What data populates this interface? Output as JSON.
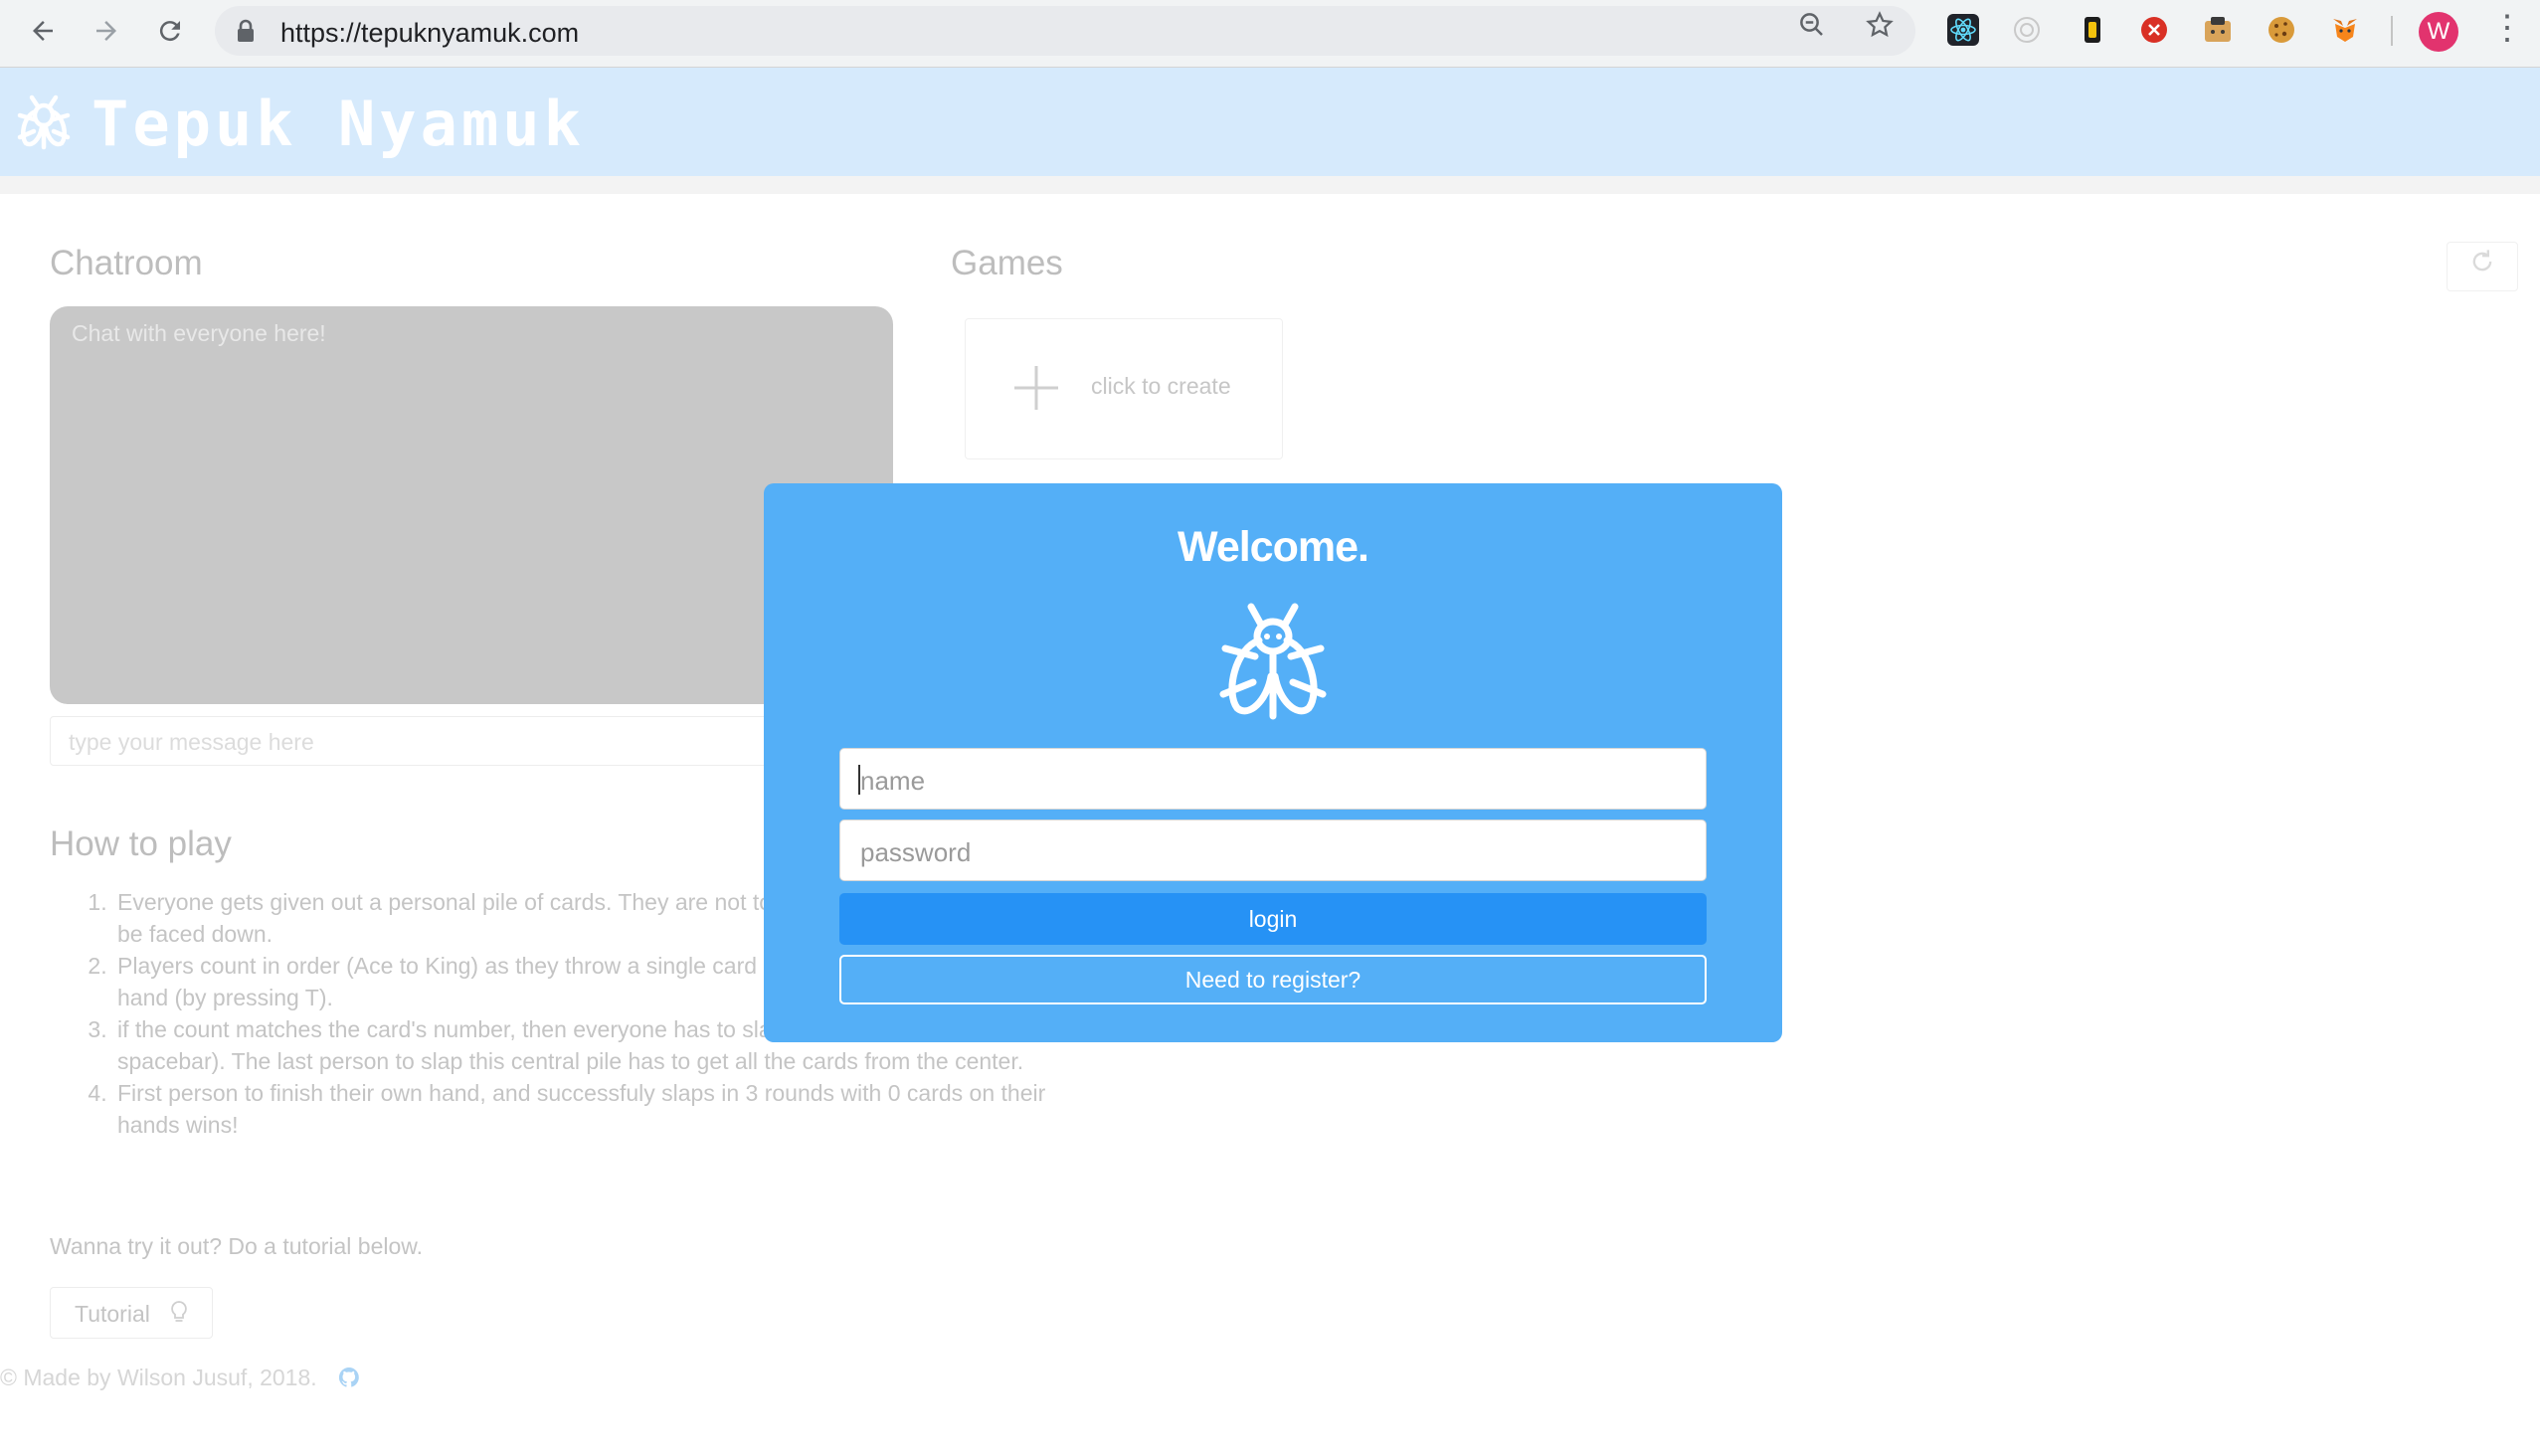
{
  "browser": {
    "url": "https://tepuknyamuk.com",
    "avatar_letter": "W"
  },
  "header": {
    "brand": "Tepuk Nyamuk"
  },
  "chatroom": {
    "title": "Chatroom",
    "chat_placeholder": "Chat with everyone here!",
    "message_placeholder": "type your message here"
  },
  "games": {
    "title": "Games",
    "create_label": "click to create"
  },
  "how_to_play": {
    "title": "How to play",
    "rules": [
      "Everyone gets given out a personal pile of cards. They are not to look at their hand, and must be faced down.",
      "Players count in order (Ace to King) as they throw a single card into the center from their hand (by pressing T).",
      "if the count matches the card's number, then everyone has to slap the pile (pressing spacebar). The last person to slap this central pile has to get all the cards from the center.",
      "First person to finish their own hand, and successfuly slaps in 3 rounds with 0 cards on their hands wins!"
    ],
    "try_text": "Wanna try it out? Do a tutorial below.",
    "tutorial_label": "Tutorial"
  },
  "footer": {
    "text": "© Made by Wilson Jusuf, 2018."
  },
  "modal": {
    "title": "Welcome.",
    "name_placeholder": "name",
    "password_placeholder": "password",
    "login_label": "login",
    "register_label": "Need to register?"
  }
}
